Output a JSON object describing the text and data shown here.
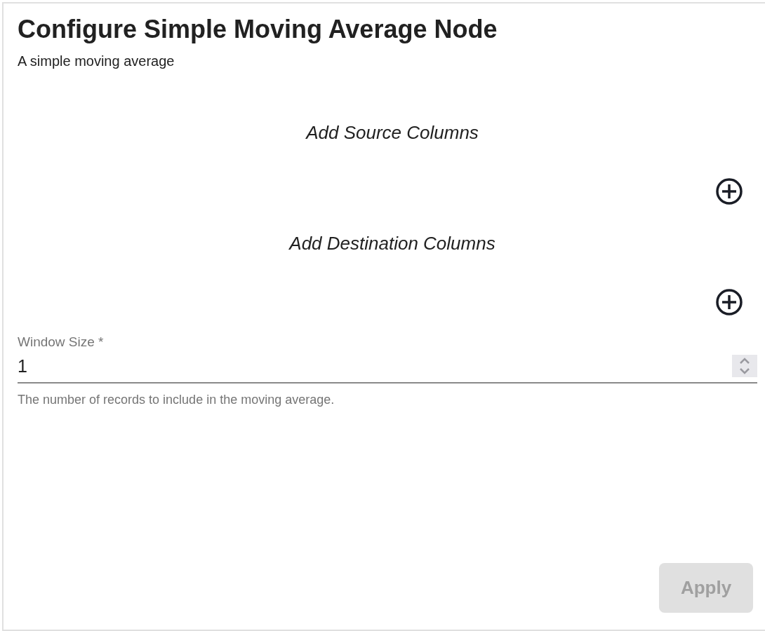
{
  "title": "Configure Simple Moving Average Node",
  "description": "A simple moving average",
  "sections": [
    {
      "heading": "Add Source Columns"
    },
    {
      "heading": "Add Destination Columns"
    }
  ],
  "window_size": {
    "label": "Window Size *",
    "value": "1",
    "helper": "The number of records to include in the moving average."
  },
  "apply_button": {
    "label": "Apply",
    "disabled": true
  }
}
